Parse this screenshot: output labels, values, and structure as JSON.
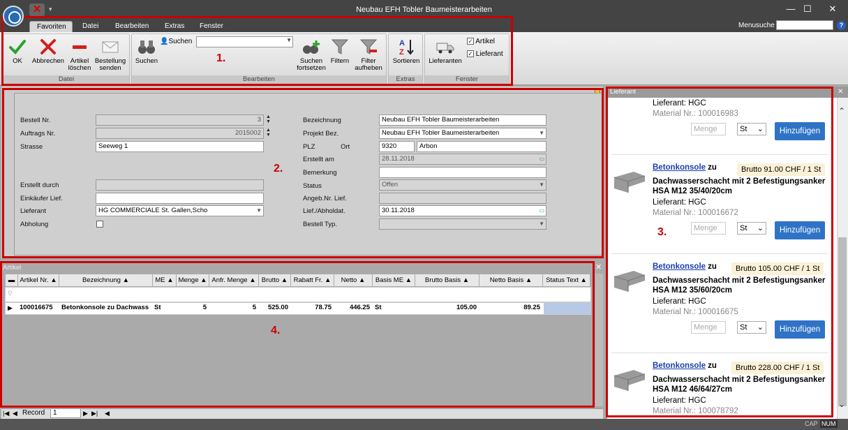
{
  "window": {
    "title": "Neubau EFH Tobler Baumeisterarbeiten",
    "minimize": "—",
    "maximize": "☐",
    "close": "✕"
  },
  "tabs": [
    {
      "label": "Favoriten",
      "active": true
    },
    {
      "label": "Datei"
    },
    {
      "label": "Bearbeiten"
    },
    {
      "label": "Extras"
    },
    {
      "label": "Fenster"
    }
  ],
  "menusuche": {
    "label": "Menusuche",
    "help": "?"
  },
  "ribbon": {
    "groups": {
      "datei": "Datei",
      "bearbeiten": "Bearbeiten",
      "extras": "Extras",
      "fenster": "Fenster"
    },
    "ok": "OK",
    "abbrechen": "Abbrechen",
    "artikel_loeschen_1": "Artikel",
    "artikel_loeschen_2": "löschen",
    "bestellung_senden_1": "Bestellung",
    "bestellung_senden_2": "senden",
    "suchen_label": "Suchen",
    "suchen_btn": "Suchen",
    "suchen_fortsetzen_1": "Suchen",
    "suchen_fortsetzen_2": "fortsetzen",
    "filtern": "Filtern",
    "filter_aufheben_1": "Filter",
    "filter_aufheben_2": "aufheben",
    "sortieren": "Sortieren",
    "lieferanten": "Lieferanten",
    "chk_artikel": "Artikel",
    "chk_lieferant": "Lieferant"
  },
  "form": {
    "bestell_nr": {
      "label": "Bestell Nr.",
      "value": "3"
    },
    "auftrags_nr": {
      "label": "Auftrags Nr.",
      "value": "2015002"
    },
    "strasse": {
      "label": "Strasse",
      "value": "Seeweg 1"
    },
    "erstellt_durch": {
      "label": "Erstellt durch",
      "value": ""
    },
    "einkaeufer": {
      "label": "Einkäufer Lief.",
      "value": ""
    },
    "lieferant": {
      "label": "Lieferant",
      "value": "HG COMMERCIALE St. Gallen,Scho"
    },
    "abholung": {
      "label": "Abholung"
    },
    "bezeichnung": {
      "label": "Bezeichnung",
      "value": "Neubau EFH Tobler Baumeisterarbeiten"
    },
    "projekt": {
      "label": "Projekt Bez.",
      "value": "Neubau EFH Tobler Baumeisterarbeiten"
    },
    "plz": {
      "label": "PLZ",
      "value": "9320"
    },
    "ort": {
      "label": "Ort",
      "value": "Arbon"
    },
    "erstellt_am": {
      "label": "Erstellt am",
      "value": "28.11.2018"
    },
    "bemerkung": {
      "label": "Bemerkung",
      "value": ""
    },
    "status": {
      "label": "Status",
      "value": "Offen"
    },
    "angeb_nr": {
      "label": "Angeb.Nr. Lief.",
      "value": ""
    },
    "lief_abholdat": {
      "label": "Lief./Abholdat.",
      "value": "30.11.2018"
    },
    "bestell_typ": {
      "label": "Bestell Typ.",
      "value": ""
    }
  },
  "grid": {
    "title": "Artikel",
    "columns": [
      "Artikel Nr.",
      "Bezeichnung",
      "ME",
      "Menge",
      "Anfr. Menge",
      "Brutto",
      "Rabatt Fr.",
      "Netto",
      "Basis ME",
      "Brutto Basis",
      "Netto Basis",
      "Status Text"
    ],
    "row": {
      "artikel_nr": "100016675",
      "bezeichnung": "Betonkonsole zu Dachwass",
      "me": "St",
      "menge": "5",
      "anfr_menge": "5",
      "brutto": "525.00",
      "rabatt": "78.75",
      "netto": "446.25",
      "basis_me": "St",
      "brutto_basis": "105.00",
      "netto_basis": "89.25"
    }
  },
  "nav": {
    "record_label": "Record",
    "record_value": "1"
  },
  "status": {
    "cap": "CAP",
    "num": "NUM"
  },
  "right_panel": {
    "title": "Lieferant",
    "top_partial": {
      "lieferant": "Lieferant: HGC",
      "matnr": "Material Nr.: 100016983",
      "menge_placeholder": "Menge",
      "unit": "St",
      "button": "Hinzufügen"
    },
    "products": [
      {
        "name": "Betonkonsole",
        "zu": "zu",
        "price": "Brutto 91.00 CHF / 1 St",
        "desc1": "Dachwasserschacht mit 2 Befestigungsanker",
        "desc2": "HSA M12 35/40/20cm",
        "lieferant": "Lieferant: HGC",
        "matnr": "Material Nr.: 100016672",
        "menge_placeholder": "Menge",
        "unit": "St",
        "button": "Hinzufügen"
      },
      {
        "name": "Betonkonsole",
        "zu": "zu",
        "price": "Brutto 105.00 CHF / 1 St",
        "desc1": "Dachwasserschacht mit 2 Befestigungsanker",
        "desc2": "HSA M12 35/60/20cm",
        "lieferant": "Lieferant: HGC",
        "matnr": "Material Nr.: 100016675",
        "menge_placeholder": "Menge",
        "unit": "St",
        "button": "Hinzufügen"
      },
      {
        "name": "Betonkonsole",
        "zu": "zu",
        "price": "Brutto 228.00 CHF / 1 St",
        "desc1": "Dachwasserschacht mit 2 Befestigungsanker",
        "desc2": "HSA M12 46/64/27cm",
        "lieferant": "Lieferant: HGC",
        "matnr": "Material Nr.: 100078792"
      }
    ]
  },
  "annotations": {
    "a1": "1.",
    "a2": "2.",
    "a3": "3.",
    "a4": "4."
  },
  "colors": {
    "annotation": "#cc0000",
    "accent": "#2f73c6",
    "price_bg": "#fbf1d6"
  }
}
